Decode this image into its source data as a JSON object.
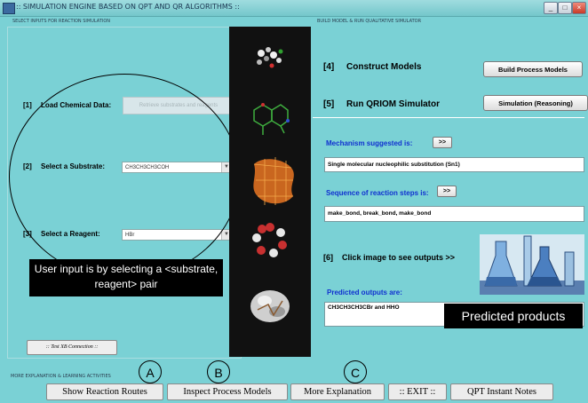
{
  "window": {
    "title": ":: SIMULATION ENGINE BASED ON QPT AND QR ALGORITHMS ::",
    "min_label": "_",
    "max_label": "□",
    "close_label": "×"
  },
  "left_panel": {
    "label": "SELECT INPUTS FOR REACTION SIMULATION",
    "load": {
      "step": "[1]",
      "label": "Load Chemical Data:",
      "button": "Retrieve substrates and reagents"
    },
    "substrate": {
      "step": "[2]",
      "label": "Select a Substrate:",
      "value": "CH3CH3CH3COH"
    },
    "reagent": {
      "step": "[3]",
      "label": "Select a Reagent:",
      "value": "HBr"
    },
    "note": "User input is by selecting a <substrate, reagent> pair",
    "xb_button": ":: Test XB Connection ::"
  },
  "right_panel": {
    "label": "BUILD MODEL & RUN QUALITATIVE SIMULATOR",
    "construct": {
      "step": "[4]",
      "label": "Construct Models",
      "button": "Build Process Models"
    },
    "run": {
      "step": "[5]",
      "label": "Run QRIOM Simulator",
      "button": "Simulation (Reasoning)"
    },
    "mechanism": {
      "label": "Mechanism suggested is:",
      "button": ">>",
      "value": "Single molecular nucleophilic substitution (Sn1)"
    },
    "sequence": {
      "label": "Sequence of reaction steps is:",
      "button": ">>",
      "value": "make_bond,  break_bond, make_bond"
    },
    "outputs": {
      "step": "[6]",
      "label": "Click image to see outputs >>",
      "predicted_label": "Predicted outputs are:",
      "value": "CH3CH3CH3CBr  and HHO"
    },
    "predicted_note": "Predicted products"
  },
  "bottom": {
    "label": "MORE EXPLANATION & LEARNING ACTIVITIES",
    "buttons": [
      "Show Reaction Routes",
      "Inspect Process Models",
      "More Explanation",
      ":: EXIT ::",
      "QPT Instant Notes"
    ],
    "markers": [
      "A",
      "B",
      "C"
    ]
  },
  "icons": [
    "app-icon",
    "molecule-image",
    "flask-image",
    "dropdown-arrow-icon"
  ]
}
